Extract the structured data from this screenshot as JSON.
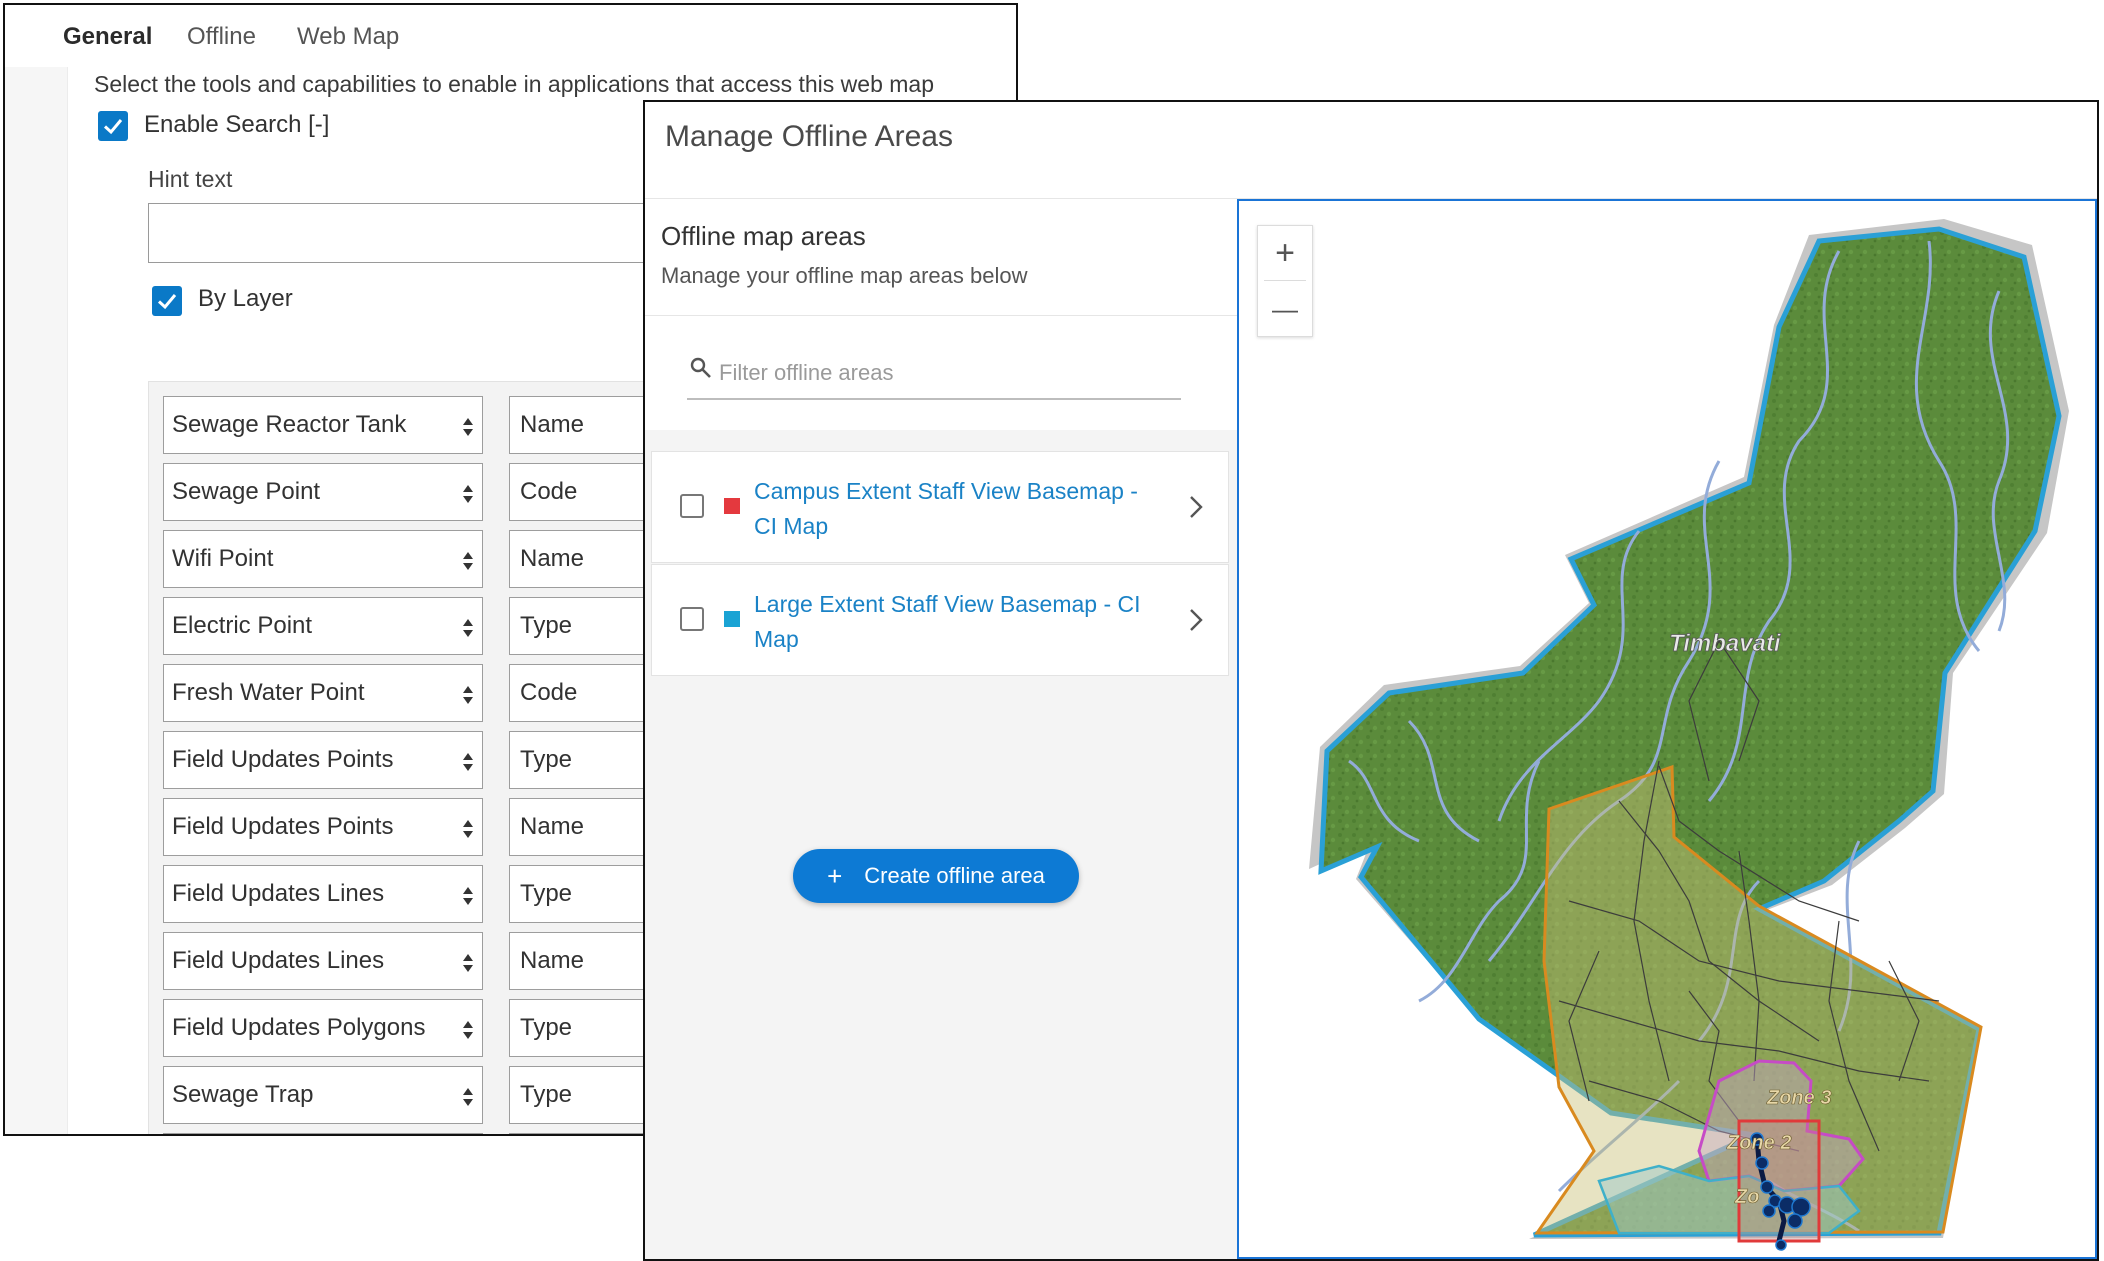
{
  "settings_panel": {
    "tabs": [
      "General",
      "Offline",
      "Web Map"
    ],
    "description": "Select the tools and capabilities to enable in applications that access this web map",
    "enable_search_label": "Enable Search [-]",
    "hint_text_label": "Hint text",
    "hint_text_value": "",
    "by_layer_label": "By Layer",
    "layer_rows": [
      {
        "layer": "Sewage Reactor Tank",
        "field": "Name"
      },
      {
        "layer": "Sewage Point",
        "field": "Code"
      },
      {
        "layer": "Wifi Point",
        "field": "Name"
      },
      {
        "layer": "Electric Point",
        "field": "Type"
      },
      {
        "layer": "Fresh Water Point",
        "field": "Code"
      },
      {
        "layer": "Field Updates Points",
        "field": "Type"
      },
      {
        "layer": "Field Updates Points",
        "field": "Name"
      },
      {
        "layer": "Field Updates Lines",
        "field": "Type"
      },
      {
        "layer": "Field Updates Lines",
        "field": "Name"
      },
      {
        "layer": "Field Updates Polygons",
        "field": "Type"
      },
      {
        "layer": "Sewage Trap",
        "field": "Type"
      }
    ]
  },
  "dialog": {
    "title": "Manage Offline Areas",
    "panel_title": "Offline map areas",
    "panel_subtitle": "Manage your offline map areas below",
    "filter_placeholder": "Filter offline areas",
    "areas": [
      {
        "line1": "Campus Extent Staff View Basemap -",
        "line2": "CI Map",
        "color": "#e4393e"
      },
      {
        "line1": "Large Extent Staff View Basemap - CI",
        "line2": "Map",
        "color": "#1aa3d4"
      }
    ],
    "create_button": "Create offline area",
    "create_button_icon": "+"
  },
  "map": {
    "zoom_in": "+",
    "zoom_out": "—",
    "region_label": "Timbavati",
    "zone_labels": [
      "Zone 3",
      "Zone 2",
      "Zo"
    ],
    "colors": {
      "outline": "#2aa0d6",
      "land": "#5a8a3a",
      "rivers": "#8fa8d8",
      "orange_area": "#d98a1f",
      "campus_area": "#e03a3a",
      "zone": "#c64bc6"
    }
  }
}
